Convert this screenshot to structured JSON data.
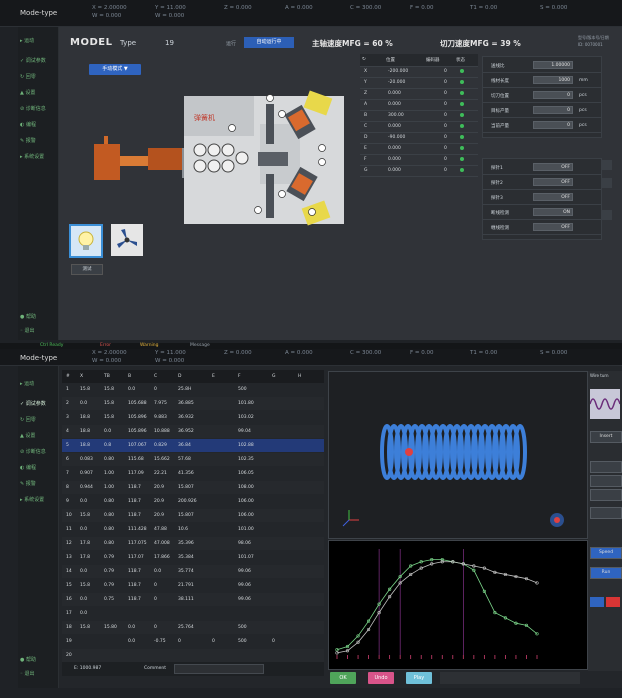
{
  "window_top": {
    "brand": "Mode-type",
    "axes": [
      {
        "name": "X",
        "value": "2.00000",
        "name2": "W",
        "value2": "0.000"
      },
      {
        "name": "Y",
        "value": "11.000",
        "name2": "W",
        "value2": "0.000"
      },
      {
        "name": "Z",
        "value": "0.000"
      },
      {
        "name": "A",
        "value": "0.000"
      },
      {
        "name": "C",
        "value": "300.00"
      },
      {
        "name": "F",
        "value": "0.00"
      },
      {
        "name": "T1",
        "value": "0.00"
      },
      {
        "name": "S",
        "value": "0.000"
      }
    ]
  },
  "nav_top": {
    "items": [
      "▸ 运动",
      "✓ 调试参数",
      "↻ 回零",
      "▲ 设置",
      "⊘ 诊断信息",
      "◐ 编程",
      "✎ 报警",
      "▸ 系统设置"
    ],
    "bottom_items": [
      "● 帮助",
      "◦ 退出"
    ]
  },
  "header": {
    "model_label": "MODEL",
    "type_label": "Type",
    "type_value": "19",
    "state_label": "运行",
    "state_badge": "自动运行中",
    "speed1_label": "主轴速度MFG = 60 %",
    "speed2_label": "切刀速度MFG = 39 %",
    "right_info_1": "型号/版本号/日期",
    "right_info_2": "ID: 0070001",
    "mode_button": "手动模式 ▼"
  },
  "machine": {
    "logo_text": "弹簧机",
    "tool_numbers": [
      "1",
      "2",
      "3",
      "4",
      "5",
      "6",
      "7",
      "8"
    ],
    "icon_bulb_label": "bulb-icon",
    "icon_fan_label": "fan-icon",
    "small_button": "测试"
  },
  "motor_table": {
    "headers": [
      "",
      "位置",
      "编码器",
      "状态"
    ],
    "rows": [
      {
        "axis": "X",
        "pos": "-200.000",
        "code": "0"
      },
      {
        "axis": "Y",
        "pos": "-20.000",
        "code": "0"
      },
      {
        "axis": "Z",
        "pos": "0.000",
        "code": "0"
      },
      {
        "axis": "A",
        "pos": "0.000",
        "code": "0"
      },
      {
        "axis": "B",
        "pos": "300.00",
        "code": "0"
      },
      {
        "axis": "C",
        "pos": "0.000",
        "code": "0"
      },
      {
        "axis": "D",
        "pos": "-90.000",
        "code": "0"
      },
      {
        "axis": "E",
        "pos": "0.000",
        "code": "0"
      },
      {
        "axis": "F",
        "pos": "0.000",
        "code": "0"
      },
      {
        "axis": "G",
        "pos": "0.000",
        "code": "0"
      }
    ]
  },
  "param_panel_1": {
    "rows": [
      {
        "label": "送线比",
        "value": "1.00000",
        "unit": ""
      },
      {
        "label": "线材长度",
        "value": "1000",
        "unit": "mm"
      },
      {
        "label": "切刀位置",
        "value": "0",
        "unit": "pcs"
      },
      {
        "label": "目标产量",
        "value": "0",
        "unit": "pcs"
      },
      {
        "label": "当前产量",
        "value": "0",
        "unit": "pcs"
      }
    ]
  },
  "param_panel_2": {
    "rows": [
      {
        "label": "探针1",
        "value": "OFF"
      },
      {
        "label": "探针2",
        "value": "OFF"
      },
      {
        "label": "探针3",
        "value": "OFF"
      },
      {
        "label": "断线检测",
        "value": "ON"
      },
      {
        "label": "缠线检测",
        "value": "OFF"
      }
    ]
  },
  "window_bottom": {
    "brand": "Mode-type",
    "status_tabs": [
      "Ctrl Ready",
      "Error",
      "Warning",
      "Message"
    ],
    "axes": [
      {
        "name": "X",
        "value": "2.00000",
        "name2": "W",
        "value2": "0.000"
      },
      {
        "name": "Y",
        "value": "11.000",
        "name2": "W",
        "value2": "0.000"
      },
      {
        "name": "Z",
        "value": "0.000"
      },
      {
        "name": "A",
        "value": "0.000"
      },
      {
        "name": "C",
        "value": "300.00"
      },
      {
        "name": "F",
        "value": "0.00"
      },
      {
        "name": "T1",
        "value": "0.00"
      },
      {
        "name": "S",
        "value": "0.000"
      }
    ]
  },
  "program_table": {
    "headers": [
      "#",
      "X",
      "TB",
      "B",
      "C",
      "D",
      "E",
      "F",
      "G",
      "H"
    ],
    "rows": [
      [
        "1",
        "15.8",
        "15.8",
        "0.0",
        "0",
        "25.8H",
        "",
        "500",
        "",
        ""
      ],
      [
        "2",
        "0.0",
        "15.8",
        "105.688",
        "7.975",
        "36.885",
        "",
        "101.80",
        "",
        ""
      ],
      [
        "3",
        "18.8",
        "15.8",
        "105.896",
        "9.883",
        "36.932",
        "",
        "103.02",
        "",
        ""
      ],
      [
        "4",
        "18.8",
        "0.0",
        "105.896",
        "10.888",
        "36.952",
        "",
        "99.04",
        "",
        ""
      ],
      [
        "5",
        "18.8",
        "0.8",
        "107.067",
        "0.829",
        "36.84",
        "",
        "102.88",
        "",
        ""
      ],
      [
        "6",
        "0.083",
        "0.80",
        "115.68",
        "15.662",
        "57.68",
        "",
        "102.35",
        "",
        ""
      ],
      [
        "7",
        "0.907",
        "1.00",
        "117.09",
        "22.21",
        "41.356",
        "",
        "106.05",
        "",
        ""
      ],
      [
        "8",
        "0.944",
        "1.00",
        "118.7",
        "20.9",
        "15.807",
        "",
        "108.00",
        "",
        ""
      ],
      [
        "9",
        "0.0",
        "0.80",
        "118.7",
        "20.9",
        "200.926",
        "",
        "106.00",
        "",
        ""
      ],
      [
        "10",
        "15.8",
        "0.80",
        "118.7",
        "20.9",
        "15.807",
        "",
        "106.00",
        "",
        ""
      ],
      [
        "11",
        "0.0",
        "0.80",
        "111.428",
        "47.88",
        "10.6",
        "",
        "101.00",
        "",
        ""
      ],
      [
        "12",
        "17.8",
        "0.80",
        "117.075",
        "47.008",
        "35.396",
        "",
        "98.06",
        "",
        ""
      ],
      [
        "13",
        "17.8",
        "0.79",
        "117.07",
        "17.866",
        "35.384",
        "",
        "101.07",
        "",
        ""
      ],
      [
        "14",
        "0.0",
        "0.79",
        "118.7",
        "0.0",
        "35.774",
        "",
        "99.06",
        "",
        ""
      ],
      [
        "15",
        "15.8",
        "0.79",
        "118.7",
        "0",
        "21.791",
        "",
        "99.06",
        "",
        ""
      ],
      [
        "16",
        "0.0",
        "0.75",
        "118.7",
        "0",
        "38.111",
        "",
        "99.06",
        "",
        ""
      ],
      [
        "17",
        "0.0",
        "",
        "",
        "",
        "",
        "",
        "",
        "",
        ""
      ],
      [
        "18",
        "15.8",
        "15.80",
        "0.0",
        "0",
        "25.764",
        "",
        "500",
        "",
        ""
      ],
      [
        "19",
        "",
        "",
        "0.0",
        "-0.75",
        "0",
        "0",
        "500",
        "0",
        ""
      ],
      [
        "20",
        "",
        "",
        "",
        "",
        "",
        "",
        "",
        "",
        ""
      ]
    ],
    "selected_index": 4,
    "footer_left": "E: 1000.987",
    "comment_label": "Comment"
  },
  "graph_buttons": [
    "OK",
    "Undo",
    "Play"
  ],
  "right_panel": {
    "label_top": "Wire turn",
    "button_1": "Insert",
    "button_2": "Speed",
    "button_3": "Run"
  },
  "chart_data": {
    "type": "line",
    "title": "",
    "xlabel": "",
    "ylabel": "",
    "series": [
      {
        "color": "#7bd68a",
        "x": [
          0,
          1,
          2,
          3,
          4,
          5,
          6,
          7,
          8,
          9,
          10,
          11,
          12,
          13,
          14,
          15,
          16,
          17,
          18,
          19
        ],
        "values": [
          5,
          8,
          18,
          32,
          48,
          62,
          74,
          84,
          88,
          90,
          90,
          88,
          86,
          80,
          60,
          40,
          35,
          30,
          28,
          20
        ]
      },
      {
        "color": "#c3c3c3",
        "x": [
          0,
          1,
          2,
          3,
          4,
          5,
          6,
          7,
          8,
          9,
          10,
          11,
          12,
          13,
          14,
          15,
          16,
          17,
          18,
          19
        ],
        "values": [
          2,
          4,
          12,
          24,
          40,
          55,
          68,
          76,
          82,
          86,
          88,
          88,
          86,
          84,
          82,
          78,
          76,
          74,
          72,
          68
        ]
      }
    ],
    "ylim": [
      0,
      100
    ]
  }
}
